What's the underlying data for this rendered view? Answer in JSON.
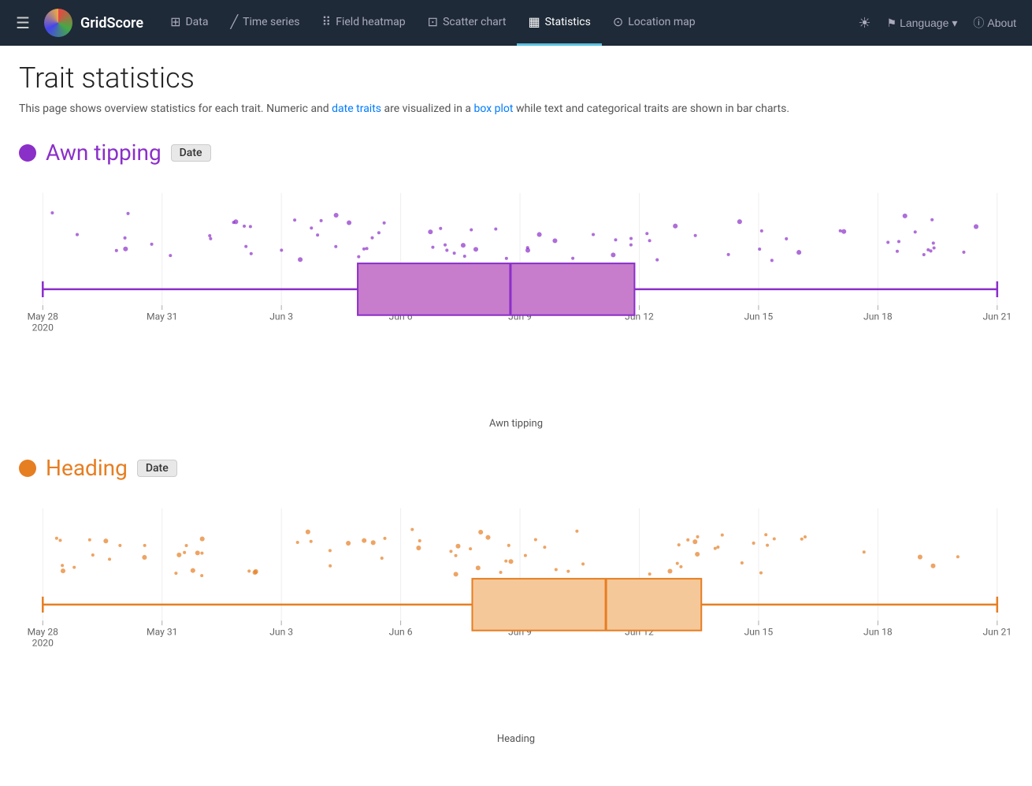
{
  "nav": {
    "brand": "GridScore",
    "hamburger_label": "☰",
    "items": [
      {
        "id": "data",
        "label": "Data",
        "icon": "⊞",
        "active": false
      },
      {
        "id": "time-series",
        "label": "Time series",
        "icon": "↗",
        "active": false
      },
      {
        "id": "field-heatmap",
        "label": "Field heatmap",
        "icon": "⠿",
        "active": false
      },
      {
        "id": "scatter-chart",
        "label": "Scatter chart",
        "icon": "⊡",
        "active": false
      },
      {
        "id": "statistics",
        "label": "Statistics",
        "icon": "▦",
        "active": true
      },
      {
        "id": "location-map",
        "label": "Location map",
        "icon": "⊞",
        "active": false
      }
    ],
    "right": {
      "theme_icon": "☀",
      "language_label": "Language",
      "language_icon": "⌄",
      "about_icon": "ⓘ",
      "about_label": "About"
    }
  },
  "page": {
    "title": "Trait statistics",
    "description": "This page shows overview statistics for each trait. Numeric and date traits are visualized in a box plot while text and categorical traits are shown in bar charts."
  },
  "traits": [
    {
      "id": "awn-tipping",
      "name": "Awn tipping",
      "badge": "Date",
      "color": "#8b2fc9",
      "dot_color": "#8b2fc9",
      "box_fill": "#c77dcc",
      "box_stroke": "#8b2fc9",
      "xlabel": "Awn tipping",
      "x_labels": [
        "May 28\n2020",
        "May 31",
        "Jun 3",
        "Jun 6",
        "Jun 9",
        "Jun 12",
        "Jun 15",
        "Jun 18",
        "Jun 21"
      ],
      "box": {
        "q1_pct": 33,
        "median_pct": 49,
        "q3_pct": 62,
        "min_pct": 0,
        "max_pct": 100
      }
    },
    {
      "id": "heading",
      "name": "Heading",
      "badge": "Date",
      "color": "#e67e22",
      "dot_color": "#e67e22",
      "box_fill": "#f5c89a",
      "box_stroke": "#e67e22",
      "xlabel": "Heading",
      "x_labels": [
        "May 28\n2020",
        "May 31",
        "Jun 3",
        "Jun 6",
        "Jun 9",
        "Jun 12",
        "Jun 15",
        "Jun 18",
        "Jun 21"
      ],
      "box": {
        "q1_pct": 45,
        "median_pct": 59,
        "q3_pct": 69,
        "min_pct": 0,
        "max_pct": 100
      }
    }
  ]
}
